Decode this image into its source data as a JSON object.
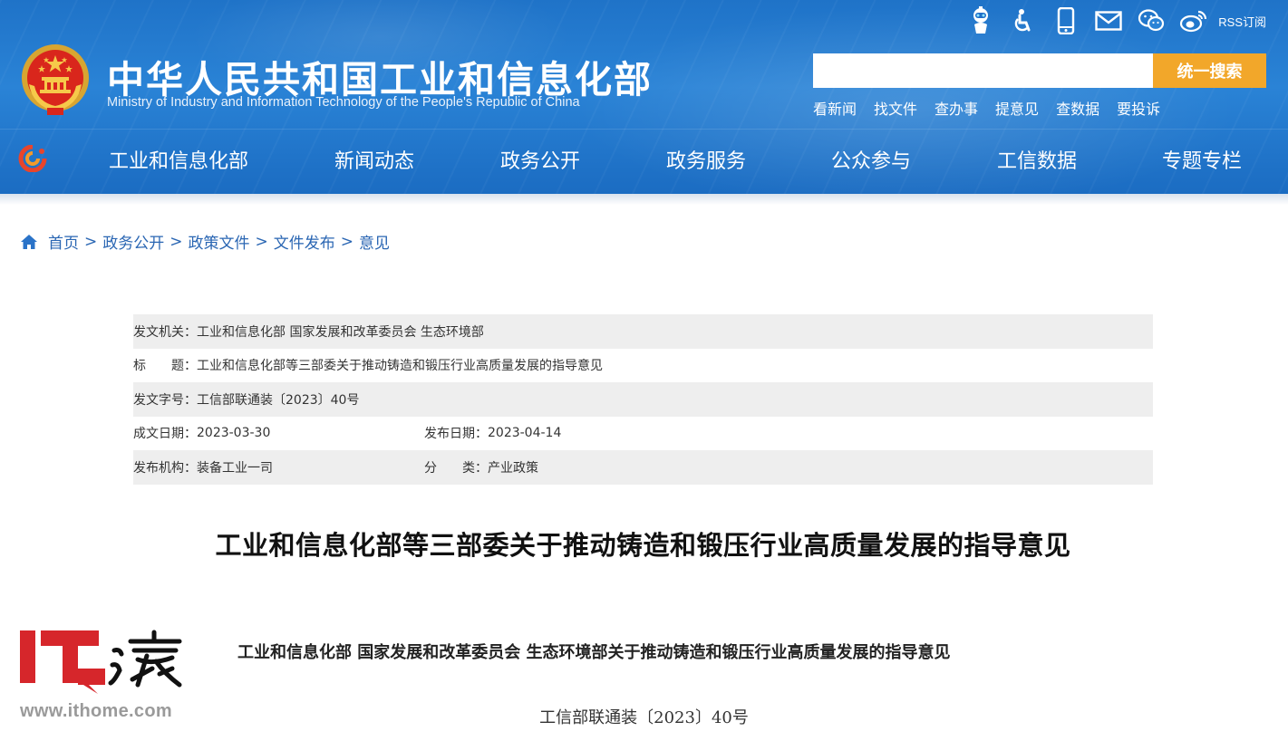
{
  "header": {
    "title_cn": "中华人民共和国工业和信息化部",
    "title_en": "Ministry of Industry and Information Technology of the People's Republic of China",
    "top_icons": [
      "robot-assistant-icon",
      "accessibility-icon",
      "mobile-icon",
      "mail-icon",
      "wechat-icon",
      "weibo-icon"
    ],
    "rss_label": "RSS订阅",
    "search": {
      "placeholder": "",
      "button_label": "统一搜索"
    },
    "quick_links": [
      "看新闻",
      "找文件",
      "查办事",
      "提意见",
      "查数据",
      "要投诉"
    ],
    "nav": [
      "工业和信息化部",
      "新闻动态",
      "政务公开",
      "政务服务",
      "公众参与",
      "工信数据",
      "专题专栏"
    ],
    "colors": {
      "header_blue": "#2a83d6",
      "search_orange": "#f2a72a"
    }
  },
  "breadcrumb": [
    "首页",
    "政务公开",
    "政策文件",
    "文件发布",
    "意见"
  ],
  "meta": {
    "issuer_label": "发文机关：",
    "issuer_value": "工业和信息化部 国家发展和改革委员会 生态环境部",
    "title_label": "标　　题：",
    "title_value": "工业和信息化部等三部委关于推动铸造和锻压行业高质量发展的指导意见",
    "doc_no_label": "发文字号：",
    "doc_no_value": "工信部联通装〔2023〕40号",
    "written_date_label": "成文日期：",
    "written_date_value": "2023-03-30",
    "publish_date_label": "发布日期：",
    "publish_date_value": "2023-04-14",
    "publisher_label": "发布机构：",
    "publisher_value": "装备工业一司",
    "category_label": "分　　类：",
    "category_value": "产业政策"
  },
  "article": {
    "title": "工业和信息化部等三部委关于推动铸造和锻压行业高质量发展的指导意见",
    "body_title": "工业和信息化部 国家发展和改革委员会 生态环境部关于推动铸造和锻压行业高质量发展的指导意见",
    "doc_number": "工信部联通装〔2023〕40号"
  },
  "watermark": {
    "url": "www.ithome.com",
    "logo_text": "IT之家"
  }
}
